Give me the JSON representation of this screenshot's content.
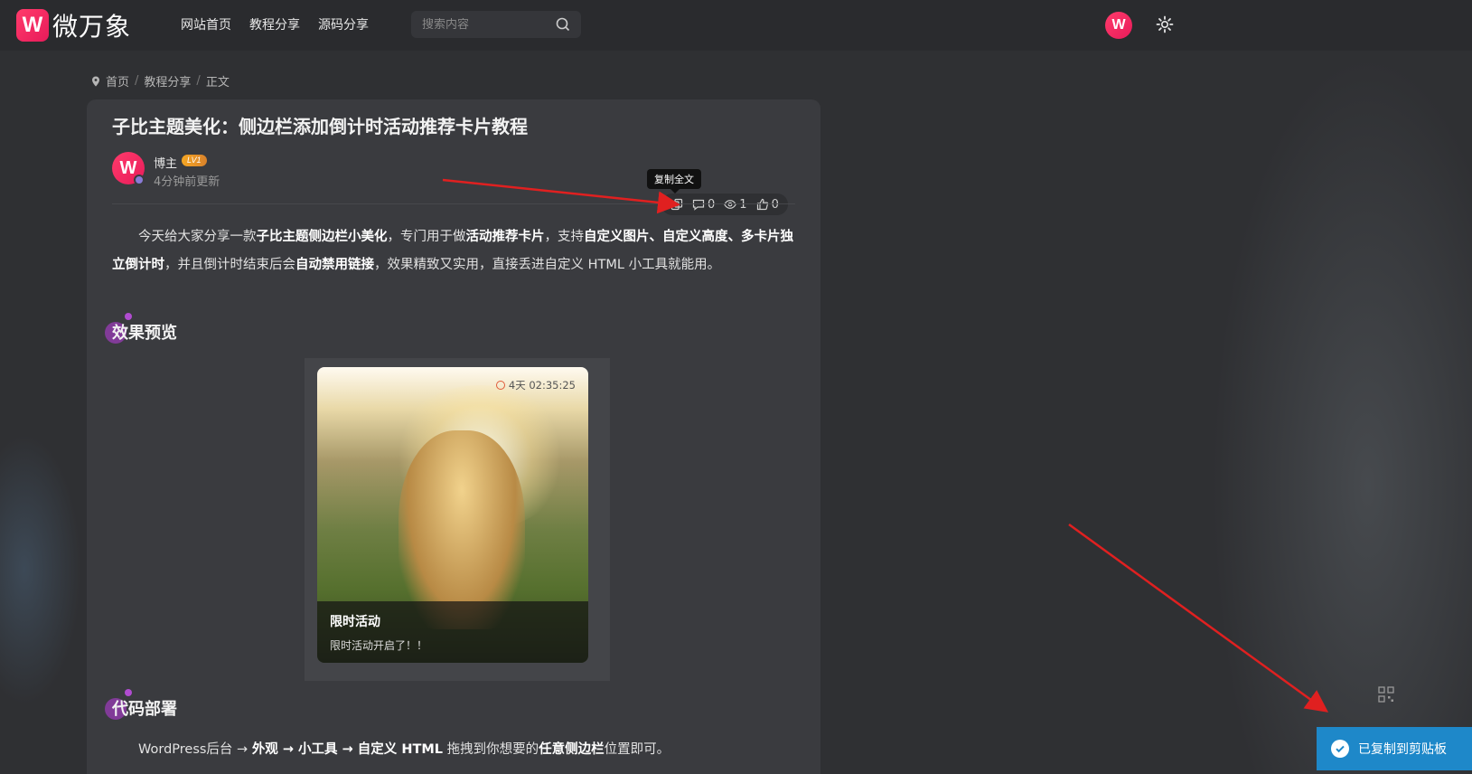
{
  "header": {
    "logo_mark": "W",
    "logo_text": "微万象",
    "nav": [
      "网站首页",
      "教程分享",
      "源码分享"
    ],
    "search_placeholder": "搜索内容",
    "avatar_letter": "W"
  },
  "breadcrumb": [
    "首页",
    "教程分享",
    "正文"
  ],
  "article": {
    "title": "子比主题美化：侧边栏添加倒计时活动推荐卡片教程",
    "author": "博主",
    "level": "LV1",
    "updated": "4分钟前更新",
    "avatar_letter": "W",
    "tooltip": "复制全文",
    "stats": {
      "comments": "0",
      "views": "1",
      "likes": "0"
    },
    "intro": {
      "p1": "今天给大家分享一款",
      "b1": "子比主题侧边栏小美化",
      "p2": "，专门用于做",
      "b2": "活动推荐卡片",
      "p3": "，支持",
      "b3": "自定义图片、自定义高度、多卡片独立倒计时",
      "p4": "，并且倒计时结束后会",
      "b4": "自动禁用链接",
      "p5": "，效果精致又实用，直接丢进自定义 HTML 小工具就能用。"
    },
    "section1": {
      "first": "效",
      "rest": "果预览"
    },
    "preview": {
      "countdown": "4天 02:35:25",
      "caption_title": "限时活动",
      "caption_sub": "限时活动开启了！！"
    },
    "section2": {
      "first": "代",
      "rest": "码部署"
    },
    "deploy": {
      "p1": "WordPress后台 → ",
      "b1": "外观 → 小工具 → 自定义 HTML",
      "p2": " 拖拽到你想要的",
      "b2": "任意侧边栏",
      "p3": "位置即可。"
    }
  },
  "toast": "已复制到剪贴板",
  "colors": {
    "accent": "#e81b5a",
    "toast": "#1e88c9",
    "heading_dot": "#b04cd0"
  }
}
